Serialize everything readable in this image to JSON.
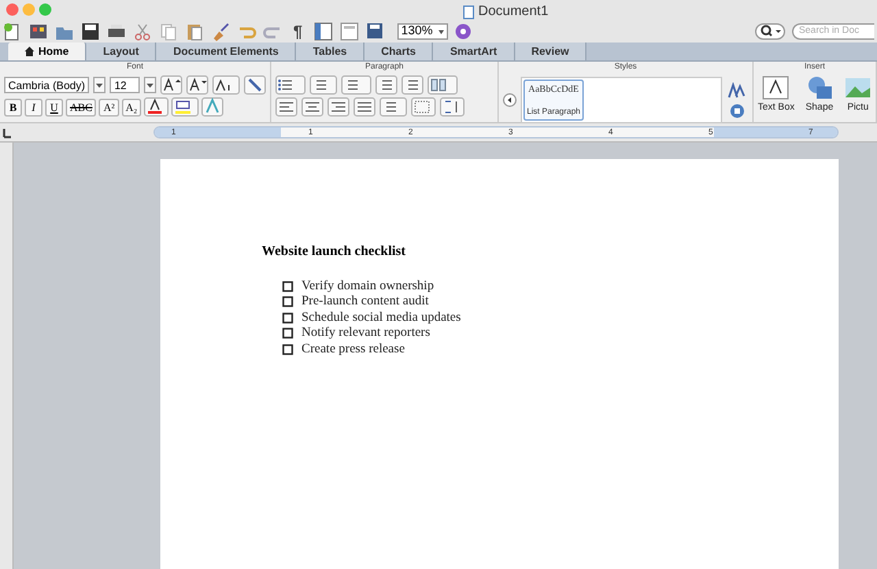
{
  "window": {
    "title": "Document1"
  },
  "toolbar": {
    "pilcrow": "¶",
    "zoom": "130%",
    "search_placeholder": "Search in Doc"
  },
  "tabs": [
    {
      "label": "Home",
      "selected": true
    },
    {
      "label": "Layout",
      "selected": false
    },
    {
      "label": "Document Elements",
      "selected": false
    },
    {
      "label": "Tables",
      "selected": false
    },
    {
      "label": "Charts",
      "selected": false
    },
    {
      "label": "SmartArt",
      "selected": false
    },
    {
      "label": "Review",
      "selected": false
    }
  ],
  "ribbon": {
    "groups": [
      "Font",
      "Paragraph",
      "Styles",
      "Insert"
    ],
    "font": {
      "name": "Cambria (Body)",
      "size": "12",
      "format_buttons": [
        "B",
        "I",
        "U",
        "ABC",
        "A²",
        "A₂"
      ]
    },
    "styles": {
      "sample": "AaBbCcDdE",
      "name": "List Paragraph"
    },
    "insert": [
      "Text Box",
      "Shape",
      "Pictu"
    ]
  },
  "ruler": [
    "1",
    "1",
    "2",
    "3",
    "4",
    "5",
    "7"
  ],
  "document": {
    "heading": "Website launch checklist",
    "items": [
      {
        "text": "Verify domain ownership",
        "checked": false
      },
      {
        "text": "Pre-launch content audit",
        "checked": false
      },
      {
        "text": "Schedule social media updates",
        "checked": false
      },
      {
        "text": "Notify relevant reporters",
        "checked": false
      },
      {
        "text": "Create press release",
        "checked": false
      }
    ]
  }
}
